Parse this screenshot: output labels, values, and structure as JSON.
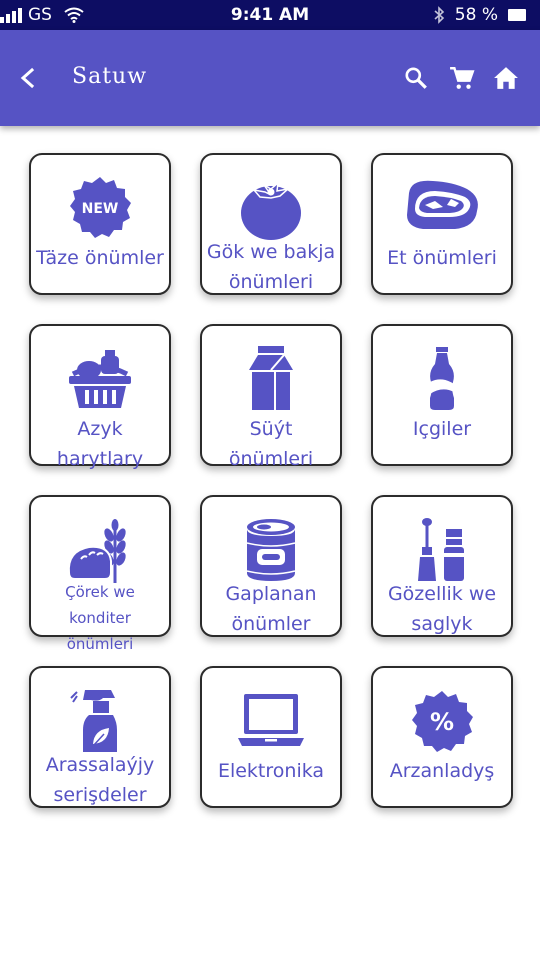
{
  "status_bar": {
    "carrier": "GS",
    "time": "9:41 AM",
    "battery": "58 %",
    "icons": [
      "signal-icon",
      "wifi-icon",
      "bluetooth-icon",
      "battery-icon"
    ]
  },
  "app_bar": {
    "title": "Satuw",
    "icons": [
      "back-arrow-icon",
      "search-icon",
      "cart-icon",
      "home-icon"
    ],
    "color": "#5653c4"
  },
  "colors": {
    "accent": "#5653c4",
    "status_bar": "#0d0d63",
    "background": "#ffffff"
  },
  "categories": [
    {
      "label": "Täze önümler",
      "icon": "new-badge-icon",
      "badge_text": "NEW"
    },
    {
      "label": "Gök we bakja önümleri",
      "icon": "tomato-icon"
    },
    {
      "label": "Et önümleri",
      "icon": "steak-icon"
    },
    {
      "label": "Azyk harytlary",
      "icon": "grocery-basket-icon"
    },
    {
      "label": "Süýt önümleri",
      "icon": "milk-carton-icon"
    },
    {
      "label": "Içgiler",
      "icon": "soda-bottle-icon"
    },
    {
      "label": "Çörek we konditer önümleri",
      "icon": "bread-wheat-icon"
    },
    {
      "label": "Gaplanan önümler",
      "icon": "canned-food-icon"
    },
    {
      "label": "Gözellik we saglyk",
      "icon": "cosmetics-icon"
    },
    {
      "label": "Arassalaýjy serişdeler",
      "icon": "spray-bottle-icon"
    },
    {
      "label": "Elektronika",
      "icon": "laptop-icon"
    },
    {
      "label": "Arzanladyş",
      "icon": "discount-badge-icon",
      "badge_text": "%"
    }
  ]
}
